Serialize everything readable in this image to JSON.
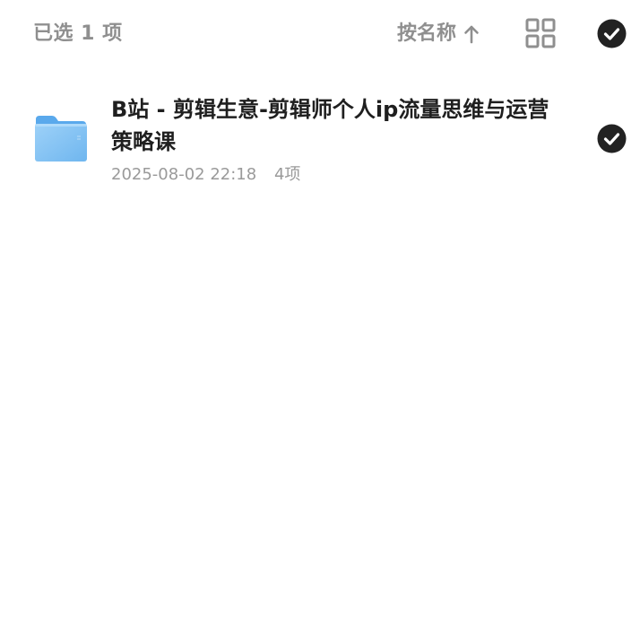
{
  "toolbar": {
    "selected_label": "已选 1 项",
    "sort_label": "按名称",
    "sort_direction_icon": "arrow-up-icon",
    "view_toggle_icon": "grid-view-icon",
    "select_all_icon": "check-circle-icon",
    "select_all_checked": true
  },
  "files": [
    {
      "name": "B站 - 剪辑生意-剪辑师个人ip流量思维与运营策略课",
      "modified": "2025-08-02 22:18",
      "item_count": "4项",
      "type_icon": "folder-icon",
      "selected": true
    }
  ],
  "colors": {
    "muted_text": "#8f8f8f",
    "primary_text": "#1f1f1f",
    "check_fill": "#222222",
    "folder_light": "#8cc8f6",
    "folder_dark": "#5aa9ec"
  }
}
